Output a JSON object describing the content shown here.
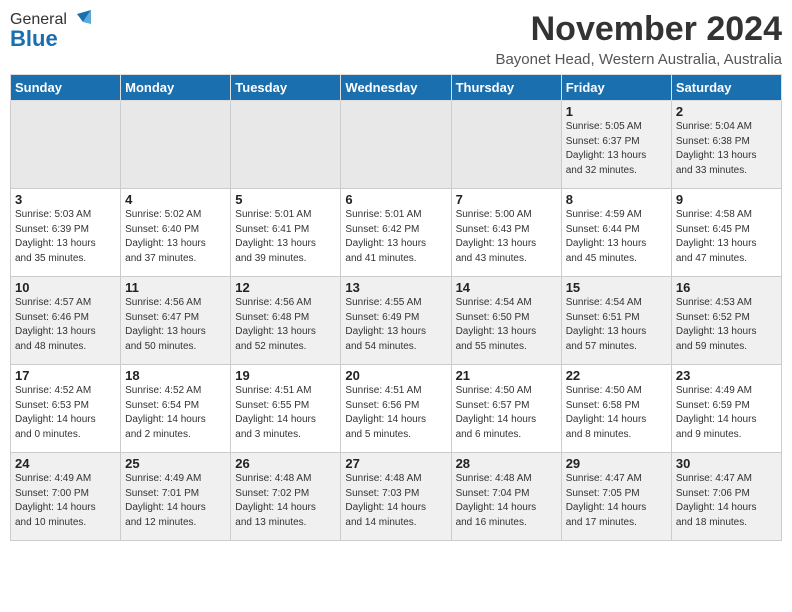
{
  "header": {
    "logo_general": "General",
    "logo_blue": "Blue",
    "month_title": "November 2024",
    "location": "Bayonet Head, Western Australia, Australia"
  },
  "weekdays": [
    "Sunday",
    "Monday",
    "Tuesday",
    "Wednesday",
    "Thursday",
    "Friday",
    "Saturday"
  ],
  "weeks": [
    [
      {
        "day": "",
        "info": ""
      },
      {
        "day": "",
        "info": ""
      },
      {
        "day": "",
        "info": ""
      },
      {
        "day": "",
        "info": ""
      },
      {
        "day": "",
        "info": ""
      },
      {
        "day": "1",
        "info": "Sunrise: 5:05 AM\nSunset: 6:37 PM\nDaylight: 13 hours\nand 32 minutes."
      },
      {
        "day": "2",
        "info": "Sunrise: 5:04 AM\nSunset: 6:38 PM\nDaylight: 13 hours\nand 33 minutes."
      }
    ],
    [
      {
        "day": "3",
        "info": "Sunrise: 5:03 AM\nSunset: 6:39 PM\nDaylight: 13 hours\nand 35 minutes."
      },
      {
        "day": "4",
        "info": "Sunrise: 5:02 AM\nSunset: 6:40 PM\nDaylight: 13 hours\nand 37 minutes."
      },
      {
        "day": "5",
        "info": "Sunrise: 5:01 AM\nSunset: 6:41 PM\nDaylight: 13 hours\nand 39 minutes."
      },
      {
        "day": "6",
        "info": "Sunrise: 5:01 AM\nSunset: 6:42 PM\nDaylight: 13 hours\nand 41 minutes."
      },
      {
        "day": "7",
        "info": "Sunrise: 5:00 AM\nSunset: 6:43 PM\nDaylight: 13 hours\nand 43 minutes."
      },
      {
        "day": "8",
        "info": "Sunrise: 4:59 AM\nSunset: 6:44 PM\nDaylight: 13 hours\nand 45 minutes."
      },
      {
        "day": "9",
        "info": "Sunrise: 4:58 AM\nSunset: 6:45 PM\nDaylight: 13 hours\nand 47 minutes."
      }
    ],
    [
      {
        "day": "10",
        "info": "Sunrise: 4:57 AM\nSunset: 6:46 PM\nDaylight: 13 hours\nand 48 minutes."
      },
      {
        "day": "11",
        "info": "Sunrise: 4:56 AM\nSunset: 6:47 PM\nDaylight: 13 hours\nand 50 minutes."
      },
      {
        "day": "12",
        "info": "Sunrise: 4:56 AM\nSunset: 6:48 PM\nDaylight: 13 hours\nand 52 minutes."
      },
      {
        "day": "13",
        "info": "Sunrise: 4:55 AM\nSunset: 6:49 PM\nDaylight: 13 hours\nand 54 minutes."
      },
      {
        "day": "14",
        "info": "Sunrise: 4:54 AM\nSunset: 6:50 PM\nDaylight: 13 hours\nand 55 minutes."
      },
      {
        "day": "15",
        "info": "Sunrise: 4:54 AM\nSunset: 6:51 PM\nDaylight: 13 hours\nand 57 minutes."
      },
      {
        "day": "16",
        "info": "Sunrise: 4:53 AM\nSunset: 6:52 PM\nDaylight: 13 hours\nand 59 minutes."
      }
    ],
    [
      {
        "day": "17",
        "info": "Sunrise: 4:52 AM\nSunset: 6:53 PM\nDaylight: 14 hours\nand 0 minutes."
      },
      {
        "day": "18",
        "info": "Sunrise: 4:52 AM\nSunset: 6:54 PM\nDaylight: 14 hours\nand 2 minutes."
      },
      {
        "day": "19",
        "info": "Sunrise: 4:51 AM\nSunset: 6:55 PM\nDaylight: 14 hours\nand 3 minutes."
      },
      {
        "day": "20",
        "info": "Sunrise: 4:51 AM\nSunset: 6:56 PM\nDaylight: 14 hours\nand 5 minutes."
      },
      {
        "day": "21",
        "info": "Sunrise: 4:50 AM\nSunset: 6:57 PM\nDaylight: 14 hours\nand 6 minutes."
      },
      {
        "day": "22",
        "info": "Sunrise: 4:50 AM\nSunset: 6:58 PM\nDaylight: 14 hours\nand 8 minutes."
      },
      {
        "day": "23",
        "info": "Sunrise: 4:49 AM\nSunset: 6:59 PM\nDaylight: 14 hours\nand 9 minutes."
      }
    ],
    [
      {
        "day": "24",
        "info": "Sunrise: 4:49 AM\nSunset: 7:00 PM\nDaylight: 14 hours\nand 10 minutes."
      },
      {
        "day": "25",
        "info": "Sunrise: 4:49 AM\nSunset: 7:01 PM\nDaylight: 14 hours\nand 12 minutes."
      },
      {
        "day": "26",
        "info": "Sunrise: 4:48 AM\nSunset: 7:02 PM\nDaylight: 14 hours\nand 13 minutes."
      },
      {
        "day": "27",
        "info": "Sunrise: 4:48 AM\nSunset: 7:03 PM\nDaylight: 14 hours\nand 14 minutes."
      },
      {
        "day": "28",
        "info": "Sunrise: 4:48 AM\nSunset: 7:04 PM\nDaylight: 14 hours\nand 16 minutes."
      },
      {
        "day": "29",
        "info": "Sunrise: 4:47 AM\nSunset: 7:05 PM\nDaylight: 14 hours\nand 17 minutes."
      },
      {
        "day": "30",
        "info": "Sunrise: 4:47 AM\nSunset: 7:06 PM\nDaylight: 14 hours\nand 18 minutes."
      }
    ]
  ]
}
